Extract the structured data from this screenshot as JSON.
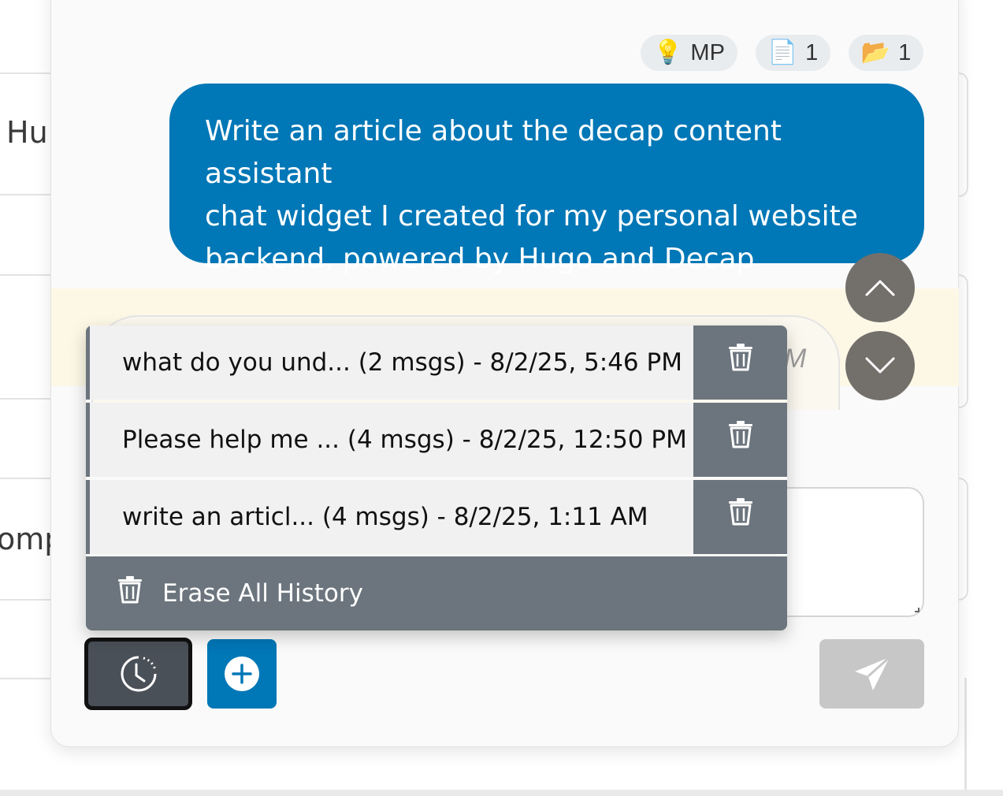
{
  "background": {
    "fragment_top": "Hu",
    "fragment_bottom": "omp"
  },
  "context_chips": [
    {
      "icon": "lightbulb-icon",
      "emoji": "💡",
      "label": "MP"
    },
    {
      "icon": "document-icon",
      "emoji": "📄",
      "label": "1"
    },
    {
      "icon": "folder-icon",
      "emoji": "📂",
      "label": "1"
    }
  ],
  "user_message": {
    "lines": [
      "Write an article about the decap content assistant",
      "chat widget I created for my personal website",
      "backend, powered by Hugo and Decap"
    ]
  },
  "assistant_time_fragment": "M",
  "history": {
    "items": [
      {
        "label": "what do you und... (2 msgs) - 8/2/25, 5:46 PM"
      },
      {
        "label": "Please help me ... (4 msgs) - 8/2/25, 12:50 PM"
      },
      {
        "label": "write an articl... (4 msgs) - 8/2/25, 1:11 AM"
      }
    ],
    "erase_all_label": "Erase All History"
  },
  "colors": {
    "primary": "#0077b6",
    "secondary": "#6c757d",
    "disabled": "#c7c7c7",
    "scroll_button": "#73706c"
  }
}
